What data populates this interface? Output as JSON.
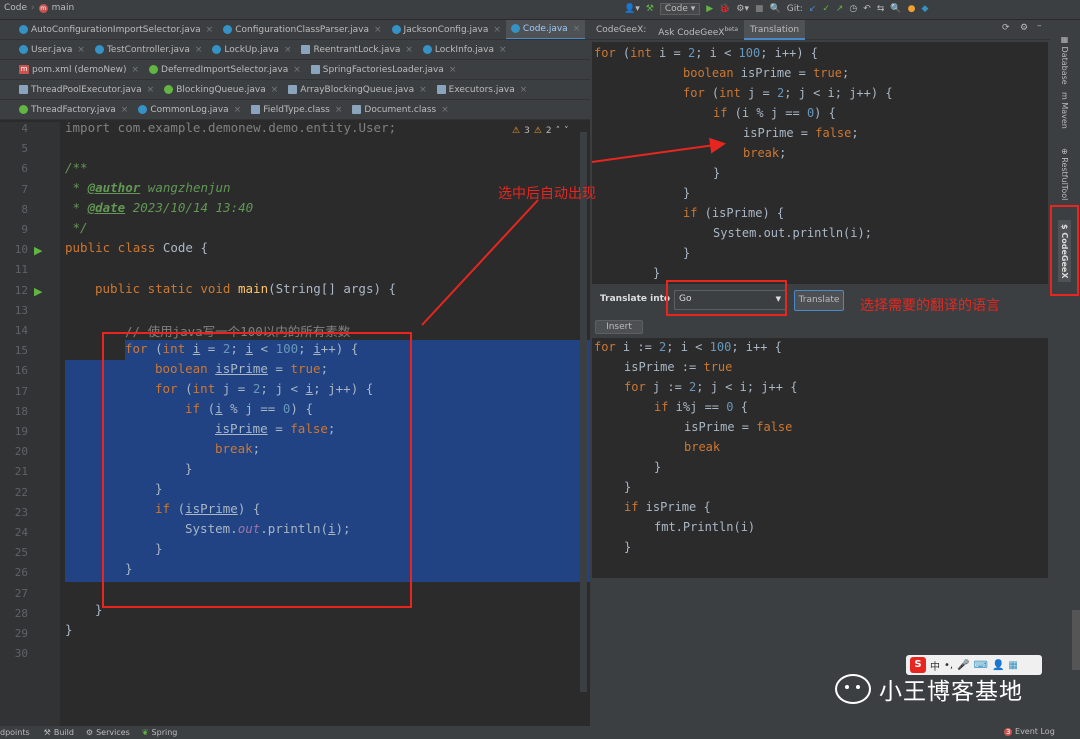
{
  "topbar": {
    "crumbs": [
      "Code",
      "main"
    ],
    "run_config": "Code",
    "git_label": "Git:"
  },
  "tabs": {
    "row1": [
      {
        "label": "AutoConfigurationImportSelector.java",
        "type": "c",
        "active": false
      },
      {
        "label": "ConfigurationClassParser.java",
        "type": "c",
        "active": false
      },
      {
        "label": "JacksonConfig.java",
        "type": "c",
        "active": false
      },
      {
        "label": "Code.java",
        "type": "c",
        "active": true
      }
    ],
    "row2": [
      {
        "label": "User.java",
        "type": "c"
      },
      {
        "label": "TestController.java",
        "type": "c"
      },
      {
        "label": "LockUp.java",
        "type": "c"
      },
      {
        "label": "ReentrantLock.java",
        "type": "cls"
      },
      {
        "label": "LockInfo.java",
        "type": "c"
      }
    ],
    "row3": [
      {
        "label": "pom.xml (demoNew)",
        "type": "m"
      },
      {
        "label": "DeferredImportSelector.java",
        "type": "i"
      },
      {
        "label": "SpringFactoriesLoader.java",
        "type": "cls"
      }
    ],
    "row4": [
      {
        "label": "ThreadPoolExecutor.java",
        "type": "cls"
      },
      {
        "label": "BlockingQueue.java",
        "type": "i"
      },
      {
        "label": "ArrayBlockingQueue.java",
        "type": "cls"
      },
      {
        "label": "Executors.java",
        "type": "cls"
      }
    ],
    "row5": [
      {
        "label": "ThreadFactory.java",
        "type": "i"
      },
      {
        "label": "CommonLog.java",
        "type": "c"
      },
      {
        "label": "FieldType.class",
        "type": "cls"
      },
      {
        "label": "Document.class",
        "type": "cls"
      }
    ]
  },
  "editor": {
    "inspections": {
      "warnings": "3",
      "weak_warnings": "2"
    },
    "line_numbers": [
      "4",
      "5",
      "6",
      "7",
      "8",
      "9",
      "10",
      "11",
      "12",
      "13",
      "14",
      "15",
      "16",
      "17",
      "18",
      "19",
      "20",
      "21",
      "22",
      "23",
      "24",
      "25",
      "26",
      "27",
      "28",
      "29",
      "30"
    ],
    "lines": {
      "l4": "import com.example.demonew.demo.entity.User;",
      "l6": "/**",
      "l7_tag": "@author",
      "l7_val": " wangzhenjun",
      "l8_tag": "@date",
      "l8_val": " 2023/10/14 13:40",
      "l9": " */",
      "l10_kw": "public class",
      "l10_rest": " Code {",
      "l12_kw": "public static void",
      "l12_fn": "main",
      "l12_rest": "(String[] args) {",
      "l14": "// 使用java写一个100以内的所有素数",
      "l26": "}",
      "l28": "}",
      "l29": "}"
    }
  },
  "translation_panel": {
    "tabs": [
      "CodeGeeX:",
      "Ask CodeGeeX",
      "Translation"
    ],
    "ask_badge": "beta",
    "translate_into_label": "Translate into",
    "language_selected": "Go",
    "translate_button": "Translate",
    "insert_button": "Insert"
  },
  "annotations": {
    "auto_appear": "选中后自动出现",
    "choose_language": "选择需要的翻译的语言"
  },
  "sidebar": [
    "Database",
    "Maven",
    "RestfulTool",
    "CodeGeeX"
  ],
  "statusbar": {
    "items": [
      "dpoints",
      "Build",
      "Services",
      "Spring"
    ],
    "event_log_count": "3",
    "event_log": "Event Log"
  },
  "watermark": {
    "text": "小王博客基地"
  },
  "colors": {
    "selection": "#214283",
    "annotation_red": "#e8261f",
    "accent": "#4a88c7"
  }
}
